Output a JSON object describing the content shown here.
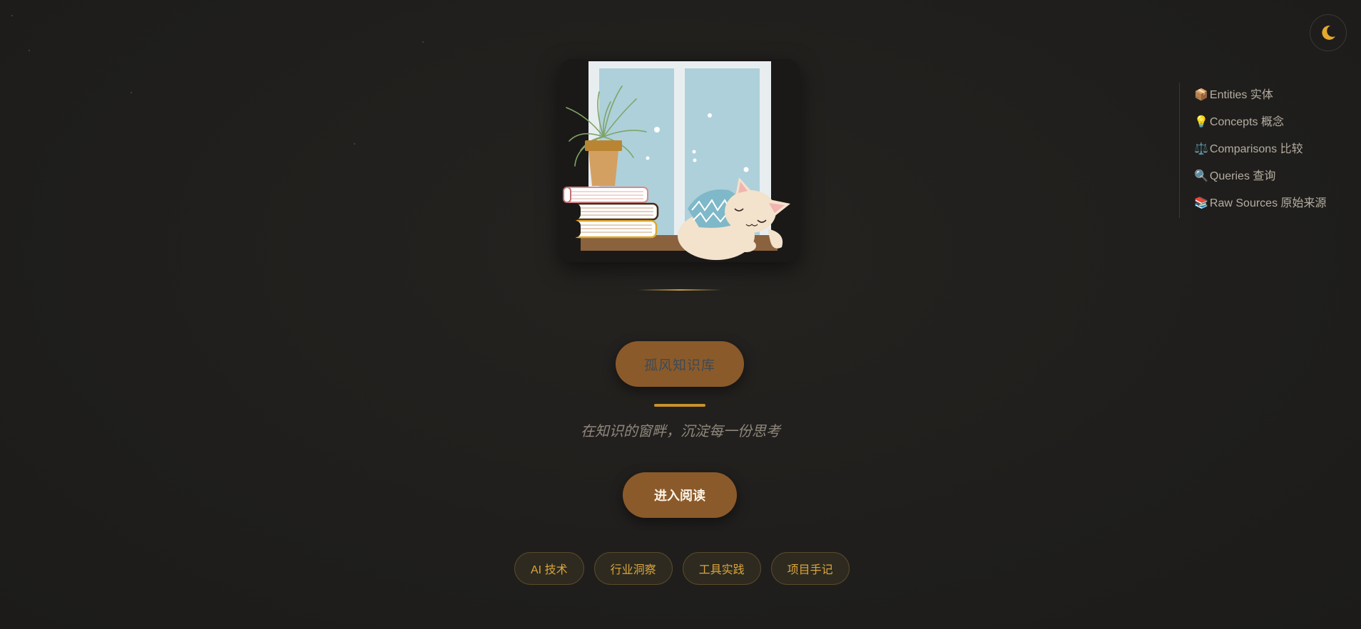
{
  "theme_toggle": {
    "icon": "moon-icon",
    "icon_color": "#e3a82d"
  },
  "toc": {
    "items": [
      {
        "icon": "📦",
        "label": "Entities 实体"
      },
      {
        "icon": "💡",
        "label": "Concepts 概念"
      },
      {
        "icon": "⚖️",
        "label": "Comparisons 比较"
      },
      {
        "icon": "🔍",
        "label": "Queries 查询"
      },
      {
        "icon": "📚",
        "label": "Raw Sources 原始来源"
      }
    ]
  },
  "hero": {
    "title": "孤风知识库",
    "subtitle": "在知识的窗畔，沉淀每一份思考",
    "cta_label": "进入阅读"
  },
  "tags": [
    {
      "label": "AI 技术"
    },
    {
      "label": "行业洞察"
    },
    {
      "label": "工具实践"
    },
    {
      "label": "项目手记"
    }
  ],
  "colors": {
    "background": "#1f1e1c",
    "accent": "#8b5a2b",
    "gold": "#c9922e",
    "tag_text": "#d9a63c"
  }
}
